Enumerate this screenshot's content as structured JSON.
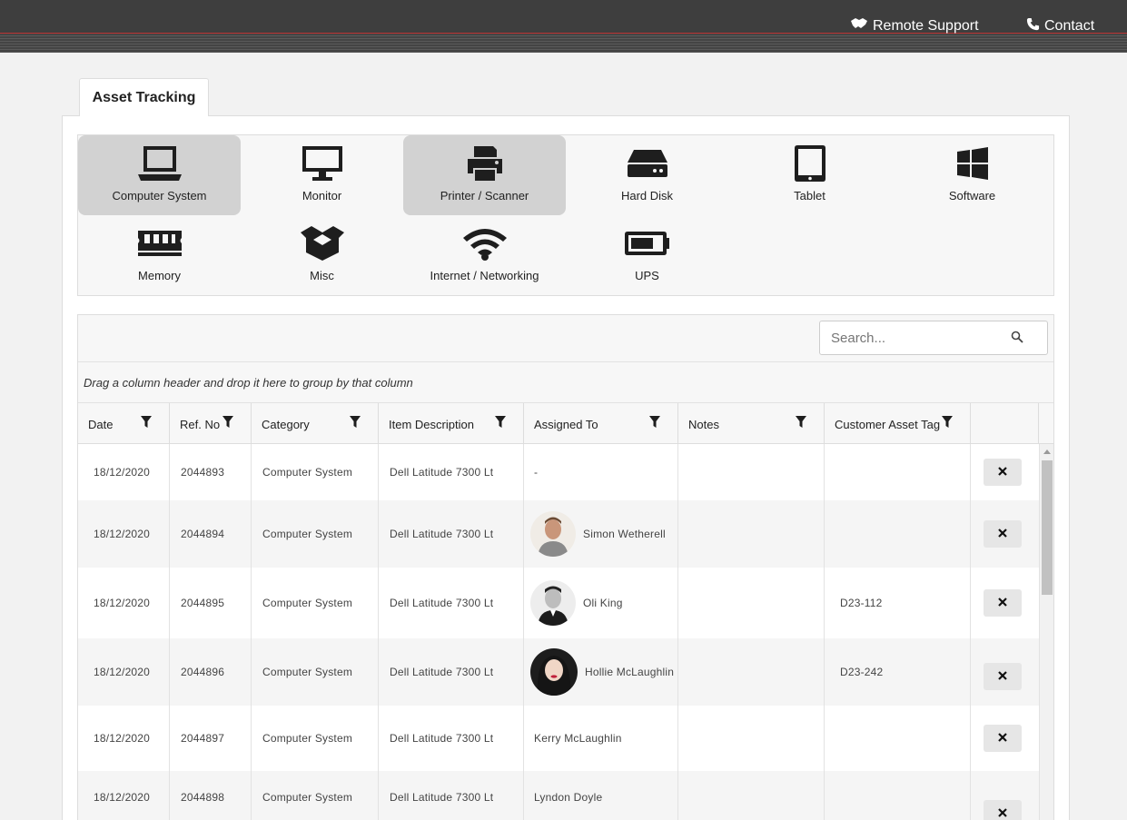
{
  "topbar": {
    "remote_support": "Remote Support",
    "contact": "Contact"
  },
  "tab": {
    "label": "Asset Tracking"
  },
  "categories": [
    {
      "label": "Computer System",
      "icon": "laptop-icon",
      "active": true
    },
    {
      "label": "Monitor",
      "icon": "monitor-icon",
      "active": false
    },
    {
      "label": "Printer / Scanner",
      "icon": "printer-icon",
      "active": true
    },
    {
      "label": "Hard Disk",
      "icon": "hard-disk-icon",
      "active": false
    },
    {
      "label": "Tablet",
      "icon": "tablet-icon",
      "active": false
    },
    {
      "label": "Software",
      "icon": "windows-icon",
      "active": false
    },
    {
      "label": "Memory",
      "icon": "memory-icon",
      "active": false
    },
    {
      "label": "Misc",
      "icon": "box-icon",
      "active": false
    },
    {
      "label": "Internet / Networking",
      "icon": "wifi-icon",
      "active": false
    },
    {
      "label": "UPS",
      "icon": "battery-icon",
      "active": false
    }
  ],
  "search": {
    "placeholder": "Search..."
  },
  "group_panel": {
    "text": "Drag a column header and drop it here to group by that column"
  },
  "columns": [
    "Date",
    "Ref. No",
    "Category",
    "Item Description",
    "Assigned To",
    "Notes",
    "Customer Asset Tag"
  ],
  "rows": [
    {
      "date": "18/12/2020",
      "ref": "2044893",
      "category": "Computer System",
      "description": "Dell Latitude 7300 Lt",
      "assigned": "-",
      "notes": "",
      "tag": ""
    },
    {
      "date": "18/12/2020",
      "ref": "2044894",
      "category": "Computer System",
      "description": "Dell Latitude 7300 Lt",
      "assigned": "Simon Wetherell",
      "notes": "",
      "tag": ""
    },
    {
      "date": "18/12/2020",
      "ref": "2044895",
      "category": "Computer System",
      "description": "Dell Latitude 7300 Lt",
      "assigned": "Oli King",
      "notes": "",
      "tag": "D23-112"
    },
    {
      "date": "18/12/2020",
      "ref": "2044896",
      "category": "Computer System",
      "description": "Dell Latitude 7300 Lt",
      "assigned": "Hollie McLaughlin",
      "notes": "",
      "tag": "D23-242"
    },
    {
      "date": "18/12/2020",
      "ref": "2044897",
      "category": "Computer System",
      "description": "Dell Latitude 7300 Lt",
      "assigned": "Kerry McLaughlin",
      "notes": "",
      "tag": ""
    },
    {
      "date": "18/12/2020",
      "ref": "2044898",
      "category": "Computer System",
      "description": "Dell Latitude 7300 Lt",
      "assigned": "Lyndon Doyle",
      "notes": "",
      "tag": ""
    }
  ],
  "colors": {
    "topbar": "#3e3e3e",
    "active_category": "#d2d2d2",
    "accent_line": "#bb3333"
  }
}
